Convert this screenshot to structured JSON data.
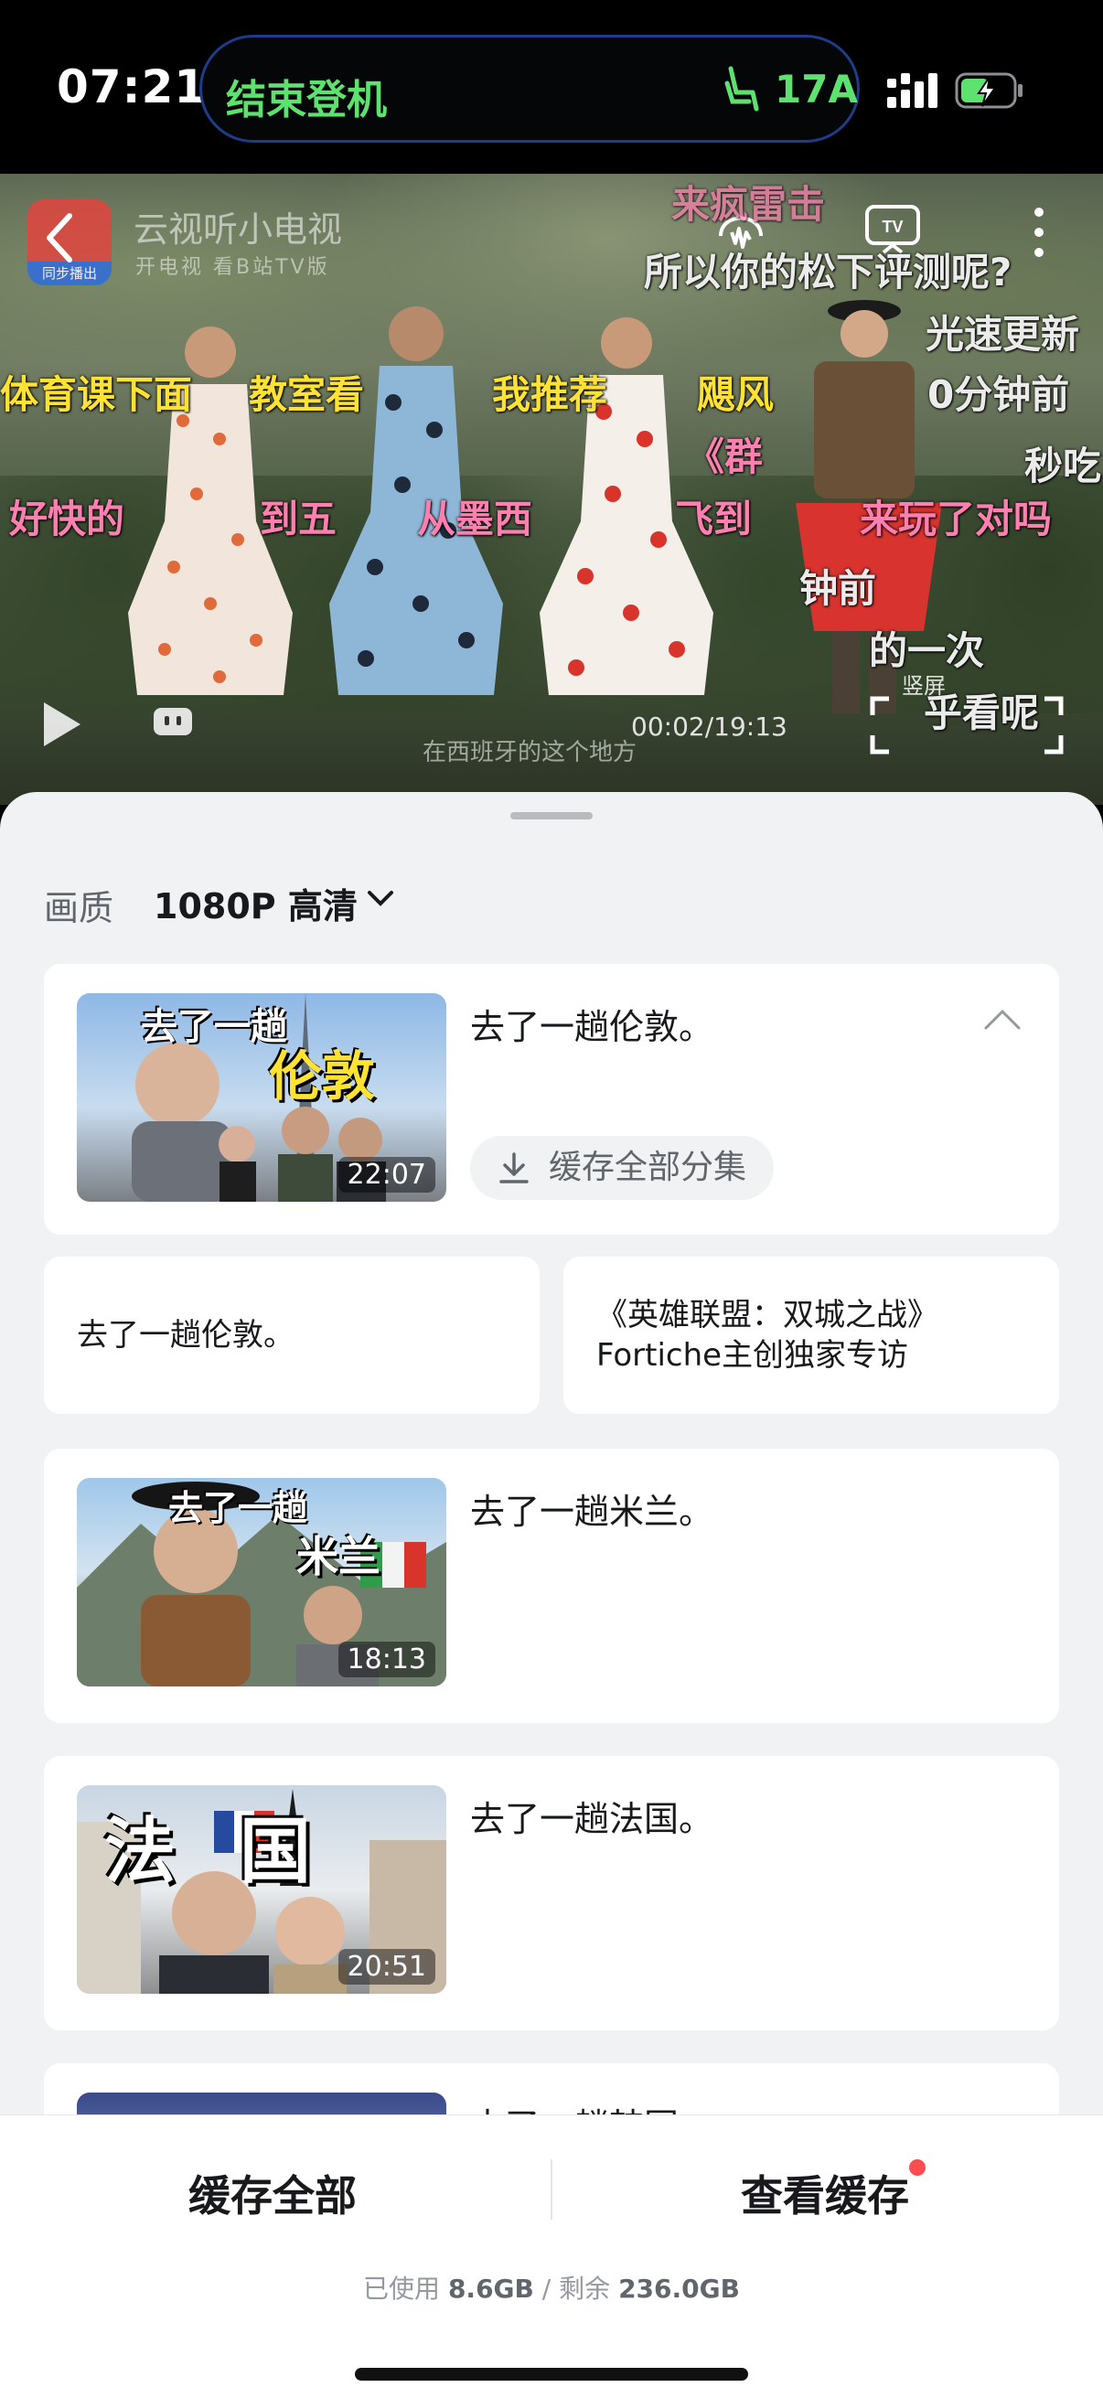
{
  "status_bar": {
    "time": "07:21",
    "live_activity_title": "结束登机",
    "seat": "17A",
    "accent_green": "#5ee26f"
  },
  "player": {
    "app_name": "云视听小电视",
    "app_subtitle": "开电视 看B站TV版",
    "app_logo_tag": "同步播出",
    "danmaku": [
      "所以你的松下评测呢?",
      "光速更新",
      "体育课下面",
      "教室看",
      "我推荐",
      "飓风",
      "0分钟前",
      "《群",
      "秒吃",
      "好快的",
      "到五",
      "从墨西",
      "飞到",
      "来玩了对吗",
      "钟前",
      "的一次",
      "乎看呢",
      "来疯雷击"
    ],
    "subtitle": "在西班牙的这个地方",
    "timecode": "00:02/19:13",
    "vertical_label": "竖屏",
    "icons": [
      "back-icon",
      "audio-mode-icon",
      "tv-cast-icon",
      "more-icon",
      "play-icon",
      "danmaku-toggle-icon",
      "fullscreen-icon"
    ]
  },
  "sheet": {
    "quality_label": "画质",
    "quality_value": "1080P 高清",
    "expanded_card": {
      "title": "去了一趟伦敦。",
      "duration": "22:07",
      "thumb_text_top": "去了一趟",
      "thumb_text_big": "伦敦",
      "cache_all_label": "缓存全部分集"
    },
    "episodes": [
      {
        "text": "去了一趟伦敦。"
      },
      {
        "text_line1": "《英雄联盟：双城之战》",
        "text_line2": "Fortiche主创独家专访"
      }
    ],
    "cards": [
      {
        "title": "去了一趟米兰。",
        "duration": "18:13",
        "thumb_text_top": "去了一趟",
        "thumb_text_big": "米兰"
      },
      {
        "title": "去了一趟法国。",
        "duration": "20:51",
        "thumb_text_big": "法国"
      },
      {
        "title": "去了一趟韩国",
        "duration": ""
      }
    ]
  },
  "action_bar": {
    "cache_all": "缓存全部",
    "view_cache": "查看缓存",
    "storage_used_label": "已使用",
    "storage_used": "8.6GB",
    "storage_sep": "/",
    "storage_free_label": "剩余",
    "storage_free": "236.0GB"
  }
}
